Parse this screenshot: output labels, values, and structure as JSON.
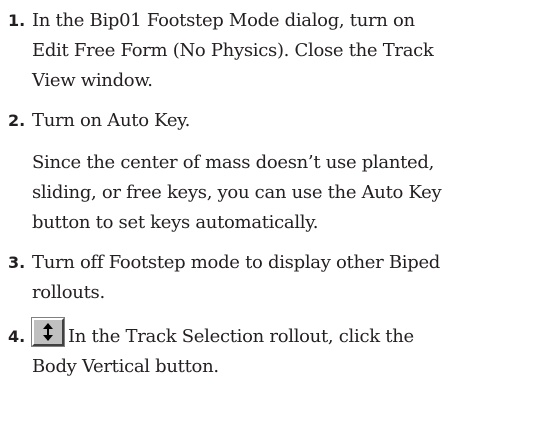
{
  "steps": [
    {
      "number": "1.",
      "text": "In the Bip01 Footstep Mode dialog, turn on\nEdit Free Form (No Physics).  Close the Track\nView window."
    },
    {
      "number": "2.",
      "text": "Turn on Auto Key.",
      "note": "Since the center of mass doesn’t use planted,\nsliding, or free keys, you can use the Auto Key\nbutton to set keys automatically."
    },
    {
      "number": "3.",
      "text": "Turn off Footstep mode to display other Biped\nrollouts."
    },
    {
      "number": "4.",
      "icon": "body-vertical-icon",
      "text": "In the Track Selection rollout, click the\nBody Vertical button."
    }
  ]
}
